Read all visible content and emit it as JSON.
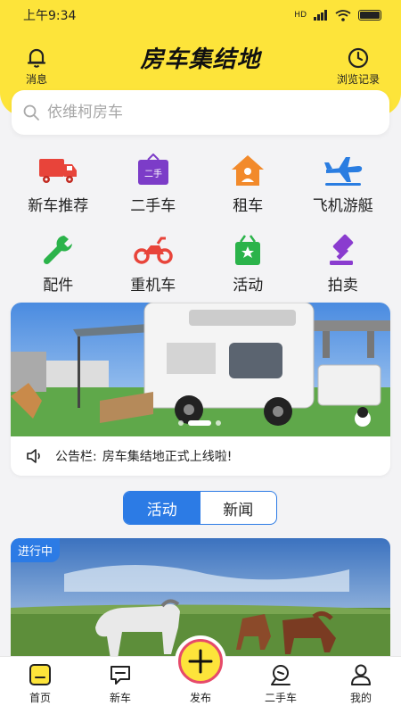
{
  "status": {
    "time": "上午9:34",
    "network": "HD",
    "signal": "4 bars",
    "wifi": "on"
  },
  "header": {
    "title": "房车集结地",
    "left_button": {
      "label": "消息",
      "icon": "bell-icon"
    },
    "right_button": {
      "label": "浏览记录",
      "icon": "clock-icon"
    },
    "background_color": "#fde43a"
  },
  "search": {
    "placeholder": "依维柯房车",
    "icon": "search-icon"
  },
  "categories": [
    {
      "label": "新车推荐",
      "icon": "truck-icon",
      "color": "#e8443a"
    },
    {
      "label": "二手车",
      "icon": "secondhand-bag-icon",
      "color": "#7c3cc8",
      "icon_text": "二手"
    },
    {
      "label": "租车",
      "icon": "house-icon",
      "color": "#f28a2b"
    },
    {
      "label": "飞机游艇",
      "icon": "airplane-icon",
      "color": "#2a7de1"
    },
    {
      "label": "配件",
      "icon": "wrench-icon",
      "color": "#2bb34a"
    },
    {
      "label": "重机车",
      "icon": "motorcycle-icon",
      "color": "#e8443a"
    },
    {
      "label": "活动",
      "icon": "gift-icon",
      "color": "#2bb34a"
    },
    {
      "label": "拍卖",
      "icon": "gavel-icon",
      "color": "#8a3ccf"
    }
  ],
  "banner": {
    "slide_count": 3,
    "active_slide": 2,
    "notice_label": "公告栏:",
    "notice_text": "房车集结地正式上线啦!"
  },
  "segment": {
    "options": [
      "活动",
      "新闻"
    ],
    "selected": "活动",
    "accent": "#2c7be5"
  },
  "activity": {
    "badge": "进行中"
  },
  "tabbar": {
    "items": [
      {
        "label": "首页",
        "icon": "home-icon",
        "active": true
      },
      {
        "label": "新车",
        "icon": "new-car-icon",
        "active": false
      },
      {
        "label": "发布",
        "icon": "plus-icon",
        "active": false
      },
      {
        "label": "二手车",
        "icon": "used-car-icon",
        "active": false
      },
      {
        "label": "我的",
        "icon": "user-icon",
        "active": false
      }
    ]
  }
}
